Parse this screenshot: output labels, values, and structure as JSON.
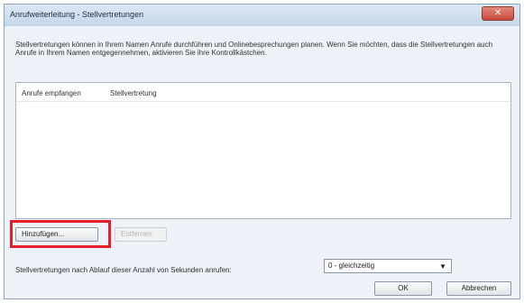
{
  "window": {
    "title": "Anrufweiterleitung - Stellvertretungen",
    "close_glyph": "✕"
  },
  "description": "Stellvertretungen können in Ihrem Namen Anrufe durchführen und Onlinebesprechungen planen. Wenn Sie möchten, dass die Stellvertretungen auch Anrufe in Ihrem Namen entgegennehmen, aktivieren Sie ihre Kontrollkästchen.",
  "list": {
    "columns": [
      "Anrufe empfangen",
      "Stellvertretung"
    ]
  },
  "buttons": {
    "add_label": "Hinzufügen...",
    "remove_label": "Entfernen",
    "ok_label": "OK",
    "cancel_label": "Abbrechen"
  },
  "delay": {
    "label": "Stellvertretungen nach Ablauf dieser Anzahl von Sekunden anrufen:",
    "selected": "0 - gleichzeitig",
    "arrow": "▼"
  },
  "colors": {
    "highlight": "#e51e2a",
    "close_button": "#c7473a"
  }
}
